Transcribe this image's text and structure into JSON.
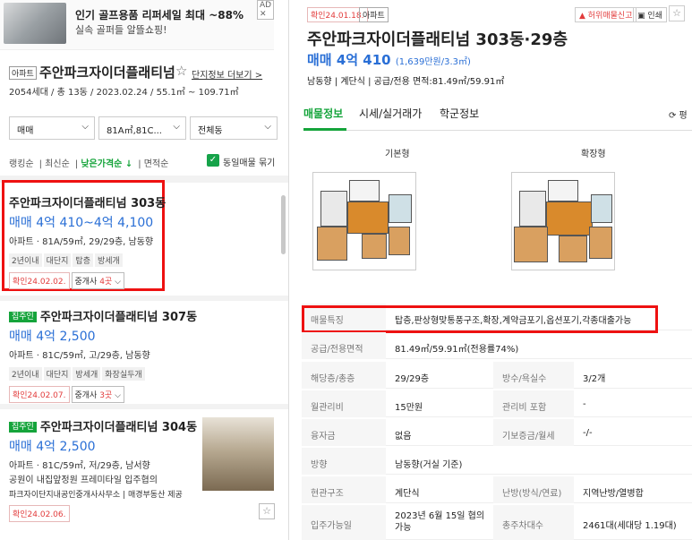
{
  "ad": {
    "title": "인기 골프용품 리퍼세일 최대 ~88%",
    "subtitle": "실속 골퍼들 알뜰쇼핑!",
    "badge": "AD ✕"
  },
  "complex": {
    "tag": "아파트",
    "name": "주안파크자이더플래티넘",
    "star": "☆",
    "more_link": "단지정보 더보기 >",
    "info": "2054세대 / 총 13동 / 2023.02.24 / 55.1㎡ ~ 109.71㎡"
  },
  "filters": {
    "trade": "매매",
    "area": "81A㎡,81C...",
    "dong": "전체동"
  },
  "sort": {
    "items": [
      "랭킹순",
      "최신순",
      "낮은가격순 ↓",
      "면적순"
    ],
    "active_index": 2,
    "check_label": "동일매물 묶기",
    "check_mark": "✓"
  },
  "listings": [
    {
      "tag": "",
      "title": "주안파크자이더플래티넘 303동",
      "price": "매매 4억 410~4억 4,100",
      "desc": "아파트 · 81A/59㎡, 29/29층, 남동향",
      "chips": [
        "2년이내",
        "대단지",
        "탑층",
        "방세개"
      ],
      "confirm": "확인24.02.02.",
      "agent_prefix": "중개사 ",
      "agent_count": "4곳",
      "agent_suffix": " ⌵"
    },
    {
      "tag": "집주인",
      "title": "주안파크자이더플래티넘 307동",
      "price": "매매 4억 2,500",
      "desc": "아파트 · 81C/59㎡, 고/29층, 남동향",
      "chips": [
        "2년이내",
        "대단지",
        "방세개",
        "화장실두개"
      ],
      "confirm": "확인24.02.07.",
      "agent_prefix": "중개사 ",
      "agent_count": "3곳",
      "agent_suffix": " ⌵"
    },
    {
      "tag": "집주인",
      "title": "주안파크자이더플래티넘 304동",
      "price": "매매 4억 2,500",
      "desc": "아파트 · 81C/59㎡, 저/29층, 남서향",
      "desc2": "공원이 내집앞정원 프레미타일 입주협의",
      "desc3": "파크자이단지내공인중개사사무소 | 매경부동산 제공",
      "confirm": "확인24.02.06."
    }
  ],
  "detail": {
    "confirm": "확인24.01.18.",
    "tag": "아파트",
    "report": "허위매물신고",
    "print": "인쇄",
    "star": "☆",
    "title": "주안파크자이더플래티넘 303동·29층",
    "price": "매매 4억 410",
    "price_per": "(1,639만원/3.3㎡)",
    "summary": "남동향 | 계단식 | 공급/전용 면적:81.49㎡/59.91㎡",
    "tabs": [
      "매물정보",
      "시세/실거래가",
      "학군정보"
    ],
    "tab_right": "⟳ 평",
    "floorplans": [
      "기본형",
      "확장형"
    ],
    "rows": [
      {
        "k": "매물특징",
        "v": "탑층,판상형맞통풍구조,확장,계약금포기,옵션포기,각종대출가능"
      },
      {
        "k": "공급/전용면적",
        "v": "81.49㎡/59.91㎡(전용률74%)"
      },
      {
        "k": "해당층/총층",
        "v": "29/29층",
        "k2": "방수/욕실수",
        "v2": "3/2개"
      },
      {
        "k": "월관리비",
        "v": "15만원",
        "k2": "관리비 포함",
        "v2": "-"
      },
      {
        "k": "융자금",
        "v": "없음",
        "k2": "기보증금/월세",
        "v2": "-/-"
      },
      {
        "k": "방향",
        "v": "남동향(거실 기준)"
      },
      {
        "k": "현관구조",
        "v": "계단식",
        "k2": "난방(방식/연료)",
        "v2": "지역난방/열병합"
      },
      {
        "k": "입주가능일",
        "v": "2023년 6월 15일 협의 가능",
        "k2": "총주차대수",
        "v2": "2461대(세대당 1.19대)"
      }
    ]
  }
}
